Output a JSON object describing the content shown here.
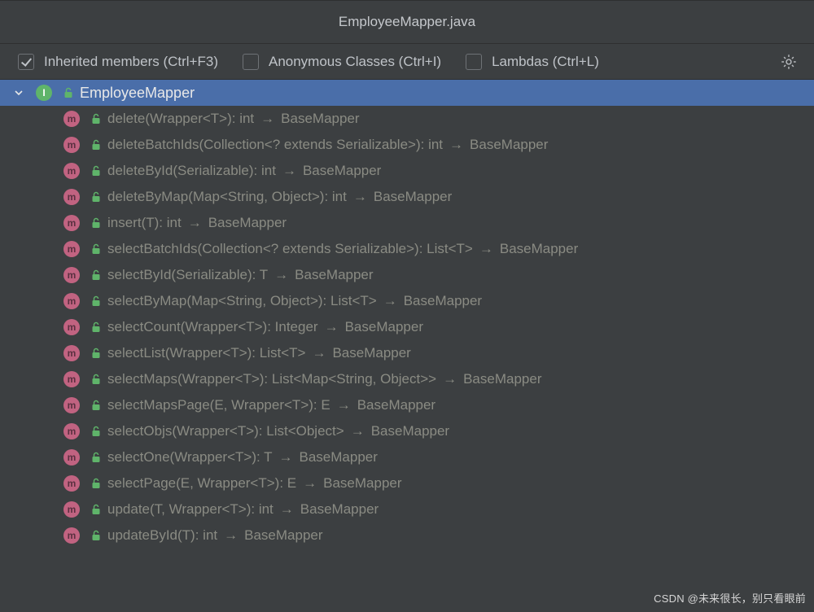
{
  "title": "EmployeeMapper.java",
  "filters": {
    "inherited": {
      "label": "Inherited members (Ctrl+F3)",
      "checked": true
    },
    "anonymous": {
      "label": "Anonymous Classes (Ctrl+I)",
      "checked": false
    },
    "lambdas": {
      "label": "Lambdas (Ctrl+L)",
      "checked": false
    }
  },
  "root": {
    "badge": "I",
    "name": "EmployeeMapper"
  },
  "methods": [
    {
      "sig": "delete(Wrapper<T>): int",
      "from": "BaseMapper"
    },
    {
      "sig": "deleteBatchIds(Collection<? extends Serializable>): int",
      "from": "BaseMapper"
    },
    {
      "sig": "deleteById(Serializable): int",
      "from": "BaseMapper"
    },
    {
      "sig": "deleteByMap(Map<String, Object>): int",
      "from": "BaseMapper"
    },
    {
      "sig": "insert(T): int",
      "from": "BaseMapper"
    },
    {
      "sig": "selectBatchIds(Collection<? extends Serializable>): List<T>",
      "from": "BaseMapper"
    },
    {
      "sig": "selectById(Serializable): T",
      "from": "BaseMapper"
    },
    {
      "sig": "selectByMap(Map<String, Object>): List<T>",
      "from": "BaseMapper"
    },
    {
      "sig": "selectCount(Wrapper<T>): Integer",
      "from": "BaseMapper"
    },
    {
      "sig": "selectList(Wrapper<T>): List<T>",
      "from": "BaseMapper"
    },
    {
      "sig": "selectMaps(Wrapper<T>): List<Map<String, Object>>",
      "from": "BaseMapper"
    },
    {
      "sig": "selectMapsPage(E, Wrapper<T>): E",
      "from": "BaseMapper"
    },
    {
      "sig": "selectObjs(Wrapper<T>): List<Object>",
      "from": "BaseMapper"
    },
    {
      "sig": "selectOne(Wrapper<T>): T",
      "from": "BaseMapper"
    },
    {
      "sig": "selectPage(E, Wrapper<T>): E",
      "from": "BaseMapper"
    },
    {
      "sig": "update(T, Wrapper<T>): int",
      "from": "BaseMapper"
    },
    {
      "sig": "updateById(T): int",
      "from": "BaseMapper"
    }
  ],
  "watermark": "CSDN @未来很长，别只看眼前"
}
